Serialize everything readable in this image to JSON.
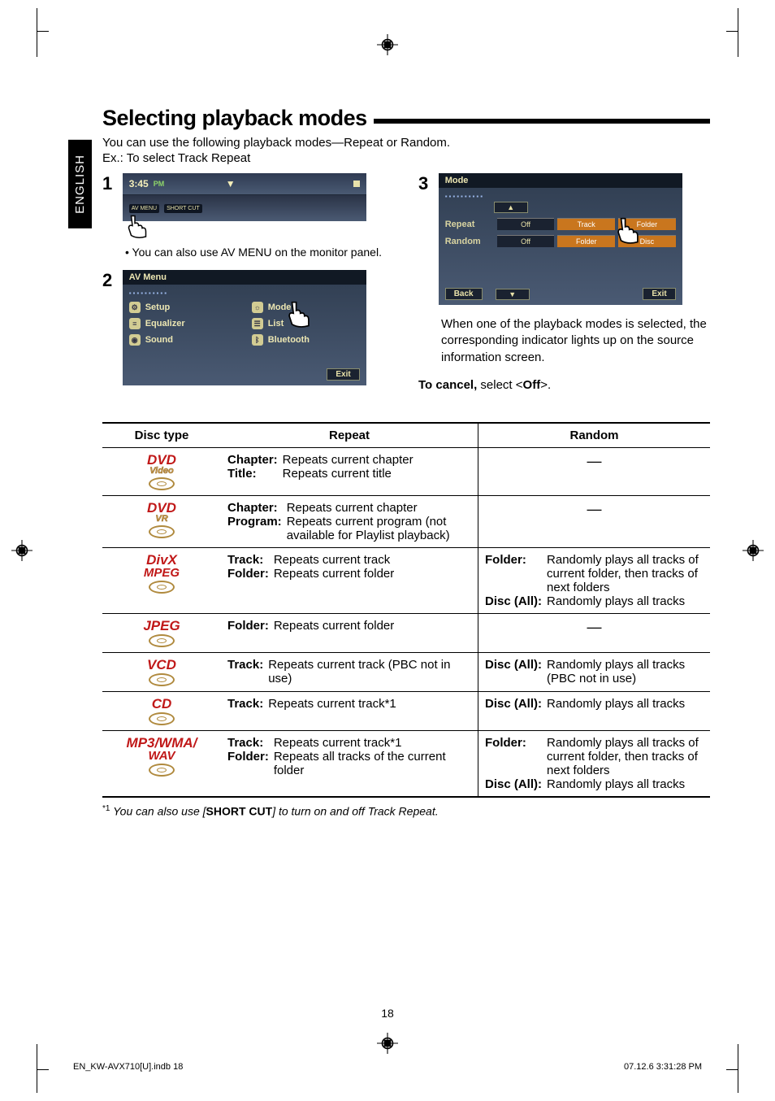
{
  "lang_tab": "ENGLISH",
  "title": "Selecting playback modes",
  "intro": "You can use the following playback modes—Repeat or Random.",
  "example": "Ex.: To select Track Repeat",
  "steps": {
    "s1": "1",
    "s2": "2",
    "s3": "3"
  },
  "screen1": {
    "time": "3:45",
    "ampm": "PM",
    "btn_avmenu": "AV MENU",
    "btn_shortcut": "SHORT CUT"
  },
  "note1": "You can also use AV MENU on the monitor panel.",
  "screen2": {
    "title": "AV Menu",
    "items": {
      "setup": "Setup",
      "equalizer": "Equalizer",
      "sound": "Sound",
      "mode": "Mode",
      "list": "List",
      "bluetooth": "Bluetooth"
    },
    "exit": "Exit"
  },
  "screen3": {
    "title": "Mode",
    "rows": {
      "repeat": {
        "label": "Repeat",
        "opts": [
          "Off",
          "Track",
          "Folder"
        ]
      },
      "random": {
        "label": "Random",
        "opts": [
          "Off",
          "Folder",
          "Disc"
        ]
      }
    },
    "back": "Back",
    "exit": "Exit"
  },
  "body3": "When one of the playback modes is selected, the corresponding indicator lights up on the source information screen.",
  "cancel": {
    "lead": "To cancel,",
    "rest": " select <",
    "off": "Off",
    "tail": ">."
  },
  "table": {
    "headers": {
      "disc": "Disc type",
      "repeat": "Repeat",
      "random": "Random"
    },
    "rows": [
      {
        "logo": {
          "main": "DVD",
          "sub": "Video"
        },
        "repeat": [
          {
            "k": "Chapter:",
            "v": "Repeats current chapter"
          },
          {
            "k": "Title:",
            "v": "Repeats current title"
          }
        ],
        "random_dash": "—"
      },
      {
        "logo": {
          "main": "DVD",
          "sub": "VR"
        },
        "repeat": [
          {
            "k": "Chapter:",
            "v": "Repeats current chapter"
          },
          {
            "k": "Program:",
            "v": "Repeats current program (not available for Playlist playback)"
          }
        ],
        "random_dash": "—"
      },
      {
        "logo": {
          "main": "DivX",
          "sub2": "MPEG"
        },
        "repeat": [
          {
            "k": "Track:",
            "v": "Repeats current track"
          },
          {
            "k": "Folder:",
            "v": "Repeats current folder"
          }
        ],
        "random": [
          {
            "k": "Folder:",
            "v": "Randomly plays all tracks of current folder, then tracks of next folders"
          },
          {
            "k": "Disc (All):",
            "v": "Randomly plays all tracks"
          }
        ]
      },
      {
        "logo": {
          "main": "JPEG"
        },
        "repeat": [
          {
            "k": "Folder:",
            "v": "Repeats current folder"
          }
        ],
        "random_dash": "—"
      },
      {
        "logo": {
          "main": "VCD"
        },
        "repeat": [
          {
            "k": "Track:",
            "v": "Repeats current track (PBC not in use)"
          }
        ],
        "random": [
          {
            "k": "Disc (All):",
            "v": "Randomly plays all tracks (PBC not in use)"
          }
        ]
      },
      {
        "logo": {
          "main": "CD"
        },
        "repeat": [
          {
            "k": "Track:",
            "v": "Repeats current track*1"
          }
        ],
        "random": [
          {
            "k": "Disc (All):",
            "v": "Randomly plays all tracks"
          }
        ]
      },
      {
        "logo": {
          "main": "MP3/WMA/",
          "sub2": "WAV"
        },
        "repeat": [
          {
            "k": "Track:",
            "v": "Repeats current track*1"
          },
          {
            "k": "Folder:",
            "v": "Repeats all tracks of the current folder"
          }
        ],
        "random": [
          {
            "k": "Folder:",
            "v": "Randomly plays all tracks of current folder, then tracks of next folders"
          },
          {
            "k": "Disc (All):",
            "v": "Randomly plays all tracks"
          }
        ]
      }
    ]
  },
  "footnote": {
    "sup": "*1",
    "lead": "You can also use  [",
    "bold": "SHORT CUT",
    "tail": "] to turn on and off Track Repeat."
  },
  "page_number": "18",
  "footer": {
    "left": "EN_KW-AVX710[U].indb   18",
    "right": "07.12.6   3:31:28 PM"
  }
}
